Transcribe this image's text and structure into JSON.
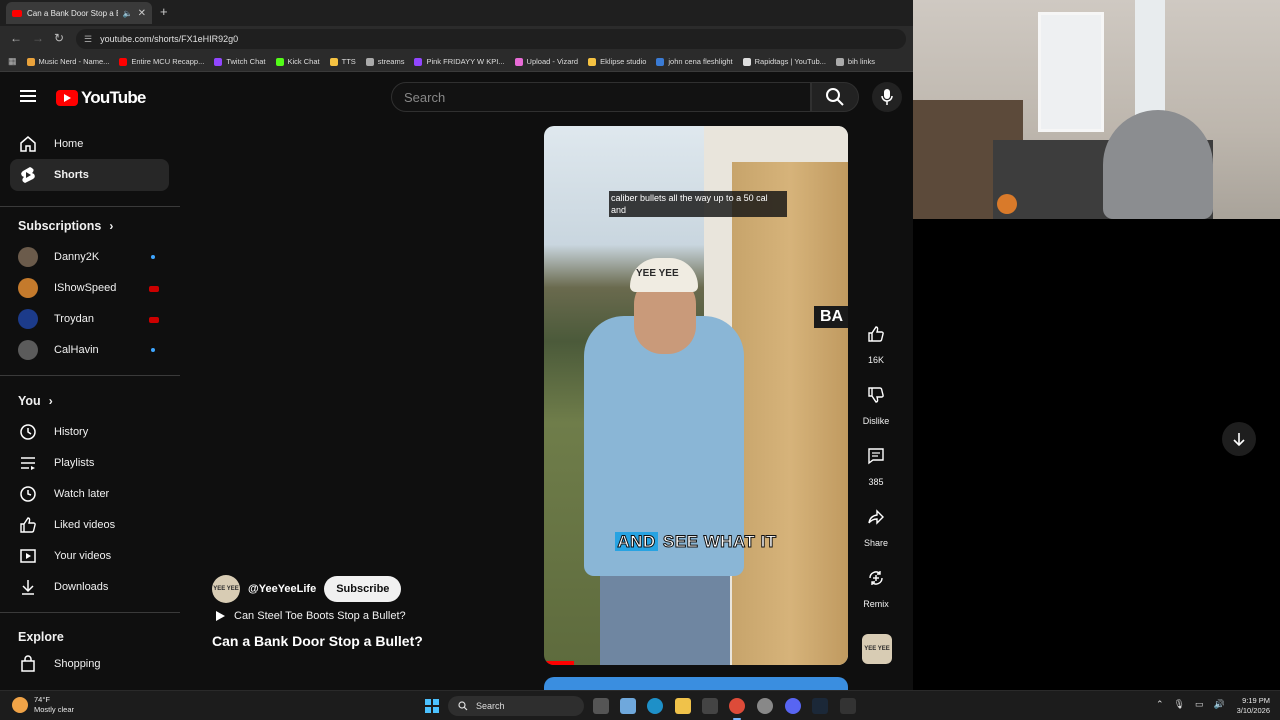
{
  "browser": {
    "tab_title": "Can a Bank Door Stop a Bu",
    "url": "youtube.com/shorts/FX1eHIR92g0",
    "bookmarks": [
      {
        "label": "Music Nerd - Name...",
        "color": "#e9a23b"
      },
      {
        "label": "Entire MCU Recapp...",
        "color": "#ff0000"
      },
      {
        "label": "Twitch Chat",
        "color": "#9146ff"
      },
      {
        "label": "Kick Chat",
        "color": "#53fc18"
      },
      {
        "label": "TTS",
        "color": "#f5c242"
      },
      {
        "label": "streams",
        "color": "#aaaaaa"
      },
      {
        "label": "Pink FRIDAYY W KPI...",
        "color": "#9146ff"
      },
      {
        "label": "Upload - Vizard",
        "color": "#e86bd6"
      },
      {
        "label": "Eklipse studio",
        "color": "#f5c242"
      },
      {
        "label": "john cena fleshlight",
        "color": "#3a7bd5"
      },
      {
        "label": "Rapidtags | YouTub...",
        "color": "#dddddd"
      },
      {
        "label": "bih links",
        "color": "#aaaaaa"
      }
    ]
  },
  "youtube": {
    "logo_text": "YouTube",
    "search_placeholder": "Search",
    "sidebar": {
      "home": "Home",
      "shorts": "Shorts",
      "subscriptions_heading": "Subscriptions",
      "subscriptions": [
        {
          "name": "Danny2K",
          "indicator": "dot"
        },
        {
          "name": "IShowSpeed",
          "indicator": "live"
        },
        {
          "name": "Troydan",
          "indicator": "live"
        },
        {
          "name": "CalHavin",
          "indicator": "dot"
        }
      ],
      "you_heading": "You",
      "you_items": [
        "History",
        "Playlists",
        "Watch later",
        "Liked videos",
        "Your videos",
        "Downloads"
      ],
      "explore_heading": "Explore",
      "explore_items": [
        "Shopping"
      ]
    },
    "short": {
      "caption": "caliber bullets all the way up to a 50 cal and",
      "hat_text": "YEE YEE",
      "sign_text": "BA",
      "subtitle_highlight": "AND",
      "subtitle_rest": "SEE WHAT IT",
      "channel_avatar_text": "YEE YEE",
      "channel_handle": "@YeeYeeLife",
      "subscribe_label": "Subscribe",
      "related_title": "Can Steel Toe Boots Stop a Bullet?",
      "title": "Can a Bank Door Stop a Bullet?",
      "progress": 0.1
    },
    "actions": {
      "like_count": "16K",
      "dislike_label": "Dislike",
      "comment_count": "385",
      "share_label": "Share",
      "remix_label": "Remix"
    }
  },
  "taskbar": {
    "temperature": "74°F",
    "weather": "Mostly clear",
    "search_label": "Search",
    "time": "9:19 PM",
    "date": "3/10/2026"
  }
}
